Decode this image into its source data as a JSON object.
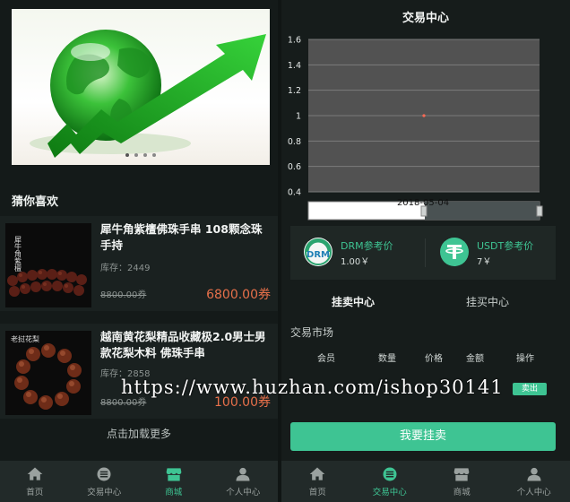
{
  "home": {
    "banner_dots": 4,
    "section_title": "猜你喜欢",
    "products": [
      {
        "name": "犀牛角紫檀佛珠手串 108颗念珠手持",
        "stock": "库存：2449",
        "old_price": "8800.00券",
        "price": "6800.00券",
        "thumb_text": "犀牛角紫檀"
      },
      {
        "name": "越南黄花梨精品收藏极2.0男士男款花梨木料 佛珠手串",
        "stock": "库存：2858",
        "old_price": "8800.00券",
        "price": "100.00券",
        "thumb_text": "老挝花梨"
      }
    ],
    "load_more": "点击加载更多"
  },
  "tabbar_left": {
    "items": [
      {
        "label": "首页",
        "icon": "home-icon"
      },
      {
        "label": "交易中心",
        "icon": "list-icon"
      },
      {
        "label": "商城",
        "icon": "shop-icon"
      },
      {
        "label": "个人中心",
        "icon": "user-icon"
      }
    ],
    "active_index": 2
  },
  "trade": {
    "title": "交易中心",
    "date_label": "2018-05-04",
    "refs": [
      {
        "label": "DRM参考价",
        "value": "1.00￥",
        "icon": "drm-logo-icon"
      },
      {
        "label": "USDT参考价",
        "value": "7￥",
        "icon": "usdt-logo-icon"
      }
    ],
    "tabs": [
      "挂卖中心",
      "挂买中心"
    ],
    "active_tab": 0,
    "market_title": "交易市场",
    "table_headers": [
      "会员",
      "数量",
      "价格",
      "金额",
      "操作"
    ],
    "row": {
      "member": "",
      "quantity": "",
      "price": "",
      "amount": "",
      "action": "卖出"
    },
    "button": "我要挂卖"
  },
  "tabbar_right": {
    "items": [
      {
        "label": "首页",
        "icon": "home-icon"
      },
      {
        "label": "交易中心",
        "icon": "list-icon"
      },
      {
        "label": "商城",
        "icon": "shop-icon"
      },
      {
        "label": "个人中心",
        "icon": "user-icon"
      }
    ],
    "active_index": 1
  },
  "watermark": "https://www.huzhan.com/ishop30141",
  "colors": {
    "accent": "#3ec493",
    "price": "#e7704a",
    "background": "#141a19",
    "chart_plot": "#525252"
  },
  "chart_data": {
    "type": "line",
    "x": [
      "2018-05-04"
    ],
    "series": [
      {
        "values": [
          1
        ]
      }
    ],
    "ylim": [
      0.4,
      1.6
    ],
    "yticks": [
      "0.4",
      "0.6",
      "0.8",
      "1",
      "1.2",
      "1.4",
      "1.6"
    ],
    "grid": true
  }
}
